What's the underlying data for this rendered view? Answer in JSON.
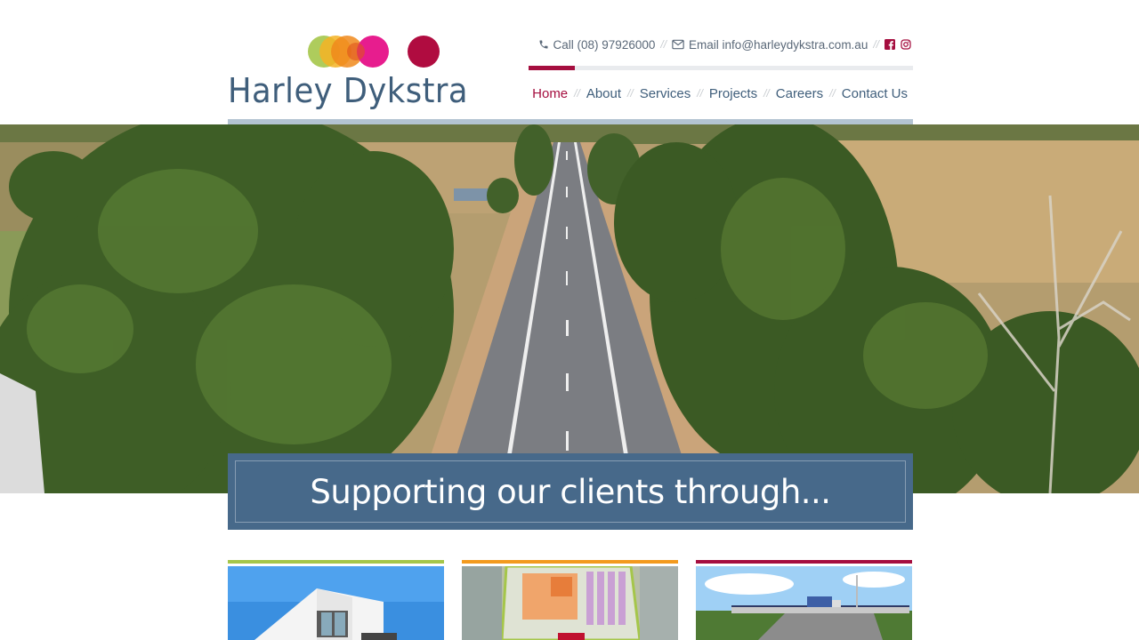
{
  "brand": {
    "name": "Harley Dykstra",
    "logo_colors": [
      "#a5c64a",
      "#f39a1e",
      "#e71d8e",
      "#b00c40"
    ],
    "text_color": "#3f5e7b",
    "accent": "#a50e3f"
  },
  "contact": {
    "phone_label": "Call (08) 97926000",
    "email_label": "Email info@harleydykstra.com.au",
    "separator": "//",
    "phone_icon": "phone-icon",
    "email_icon": "envelope-icon",
    "social": [
      "facebook-icon",
      "instagram-icon"
    ]
  },
  "nav": {
    "separator": "//",
    "active": "Home",
    "items": [
      {
        "label": "Home"
      },
      {
        "label": "About"
      },
      {
        "label": "Services"
      },
      {
        "label": "Projects"
      },
      {
        "label": "Careers"
      },
      {
        "label": "Contact Us"
      }
    ]
  },
  "hero": {
    "tagline": "Supporting our clients through..."
  },
  "cards": [
    {
      "bar_color": "#a5c64a",
      "image": "apartment-building"
    },
    {
      "bar_color": "#f39a1e",
      "image": "subdivision-plan"
    },
    {
      "bar_color": "#a50e3f",
      "image": "highway-bridge"
    }
  ]
}
